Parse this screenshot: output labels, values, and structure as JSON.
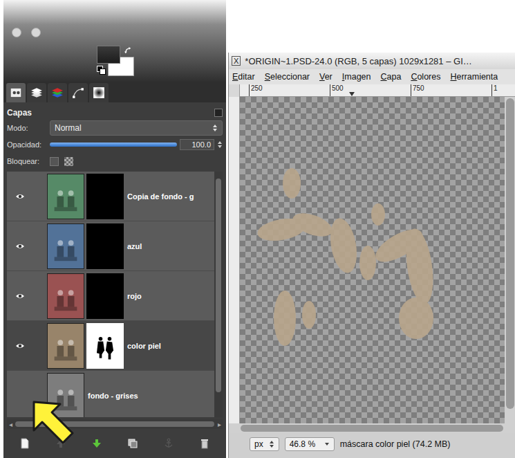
{
  "dock": {
    "tabs": [
      {
        "kind": "tool-options",
        "selected": true
      },
      {
        "kind": "layers",
        "selected": false
      },
      {
        "kind": "channels",
        "selected": false
      },
      {
        "kind": "paths",
        "selected": false
      },
      {
        "kind": "gradient",
        "selected": false
      }
    ],
    "panel_title": "Capas",
    "mode": {
      "label": "Modo:",
      "value": "Normal"
    },
    "opacity": {
      "label": "Opacidad:",
      "level": 1.0,
      "reading": "100.0"
    },
    "lock": {
      "label": "Bloquear:",
      "checked": false
    },
    "layers": [
      {
        "name": "Copia de fondo - g",
        "visible": true,
        "selected": false,
        "color": "#3f7a52",
        "mask": "black"
      },
      {
        "name": "azul",
        "visible": true,
        "selected": false,
        "color": "#3b5f8a",
        "mask": "black"
      },
      {
        "name": "rojo",
        "visible": true,
        "selected": false,
        "color": "#8c3b3b",
        "mask": "black"
      },
      {
        "name": "color piel",
        "visible": true,
        "selected": true,
        "color": "#8a7456",
        "mask": "figure"
      },
      {
        "name": "fondo - grises",
        "visible": false,
        "selected": false,
        "color": "#6b6b6b",
        "mask": "none"
      }
    ],
    "buttons": [
      {
        "kind": "new",
        "disabled": false
      },
      {
        "kind": "raise",
        "disabled": true
      },
      {
        "kind": "lower",
        "disabled": false
      },
      {
        "kind": "duplicate",
        "disabled": false
      },
      {
        "kind": "anchor",
        "disabled": true
      },
      {
        "kind": "delete",
        "disabled": false
      }
    ]
  },
  "window": {
    "icon": "X",
    "title": "*ORIGIN~1.PSD-24.0 (RGB, 5 capas) 1029x1281 – GI…"
  },
  "menu": [
    "Editar",
    "Seleccionar",
    "Ver",
    "Imagen",
    "Capa",
    "Colores",
    "Herramienta"
  ],
  "ruler": {
    "ticks": [
      "250",
      "500",
      "750",
      "1"
    ]
  },
  "status": {
    "unit": "px",
    "zoom": "46.8 %",
    "message": "máscara color piel (74.2 MB)"
  }
}
